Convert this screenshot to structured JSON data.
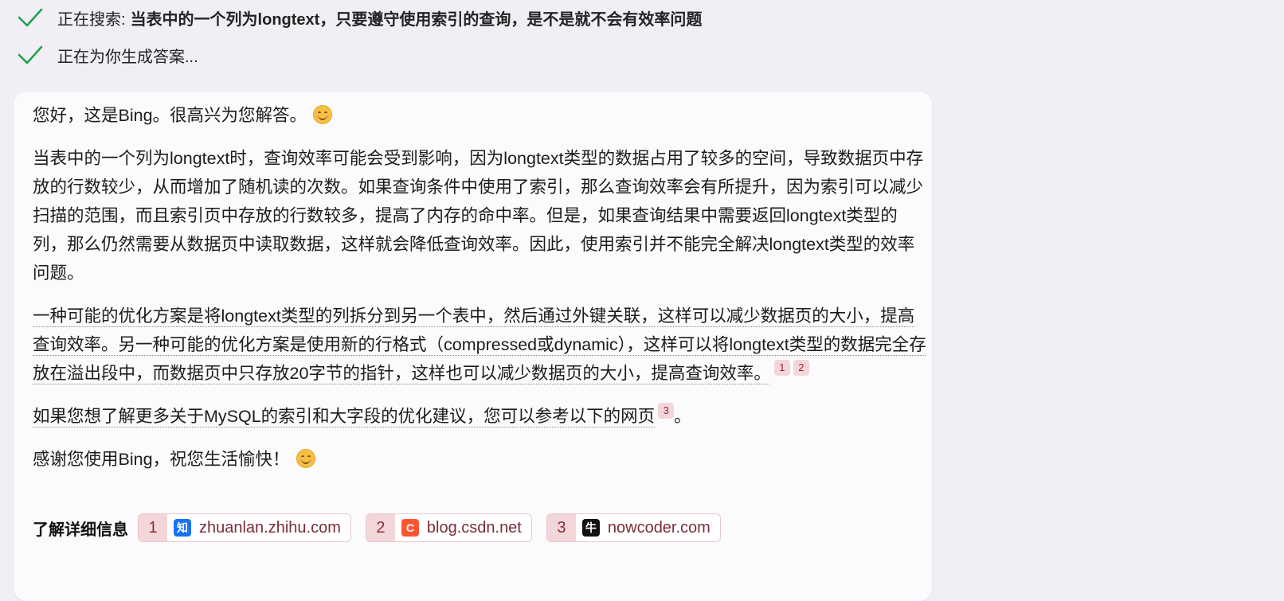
{
  "status": [
    {
      "prefix": "正在搜索:",
      "query": "当表中的一个列为longtext，只要遵守使用索引的查询，是不是就不会有效率问题"
    },
    {
      "prefix": "正在为你生成答案...",
      "query": ""
    }
  ],
  "answer": {
    "greeting": "您好，这是Bing。很高兴为您解答。",
    "para1": "当表中的一个列为longtext时，查询效率可能会受到影响，因为longtext类型的数据占用了较多的空间，导致数据页中存放的行数较少，从而增加了随机读的次数。如果查询条件中使用了索引，那么查询效率会有所提升，因为索引可以减少扫描的范围，而且索引页中存放的行数较多，提高了内存的命中率。但是，如果查询结果中需要返回longtext类型的列，那么仍然需要从数据页中读取数据，这样就会降低查询效率。因此，使用索引并不能完全解决longtext类型的效率问题。",
    "para2": "一种可能的优化方案是将longtext类型的列拆分到另一个表中，然后通过外键关联，这样可以减少数据页的大小，提高查询效率。另一种可能的优化方案是使用新的行格式（compressed或dynamic），这样可以将longtext类型的数据完全存放在溢出段中，而数据页中只存放20字节的指针，这样也可以减少数据页的大小，提高查询效率。",
    "para2_cites": [
      "1",
      "2"
    ],
    "para3": "如果您想了解更多关于MySQL的索引和大字段的优化建议，您可以参考以下的网页",
    "para3_cite": "3",
    "para3_end": "。",
    "closing": "感谢您使用Bing，祝您生活愉快！"
  },
  "learn_more": {
    "label": "了解详细信息",
    "sources": [
      {
        "num": "1",
        "icon": "zhihu-icon",
        "icon_text": "知",
        "site": "zhuanlan.zhihu.com"
      },
      {
        "num": "2",
        "icon": "csdn-icon",
        "icon_text": "C",
        "site": "blog.csdn.net"
      },
      {
        "num": "3",
        "icon": "nowcoder-icon",
        "icon_text": "牛",
        "site": "nowcoder.com"
      }
    ]
  },
  "colors": {
    "check": "#1aa14a",
    "citation_bg": "#f3d6da",
    "citation_text": "#8a2a36"
  }
}
